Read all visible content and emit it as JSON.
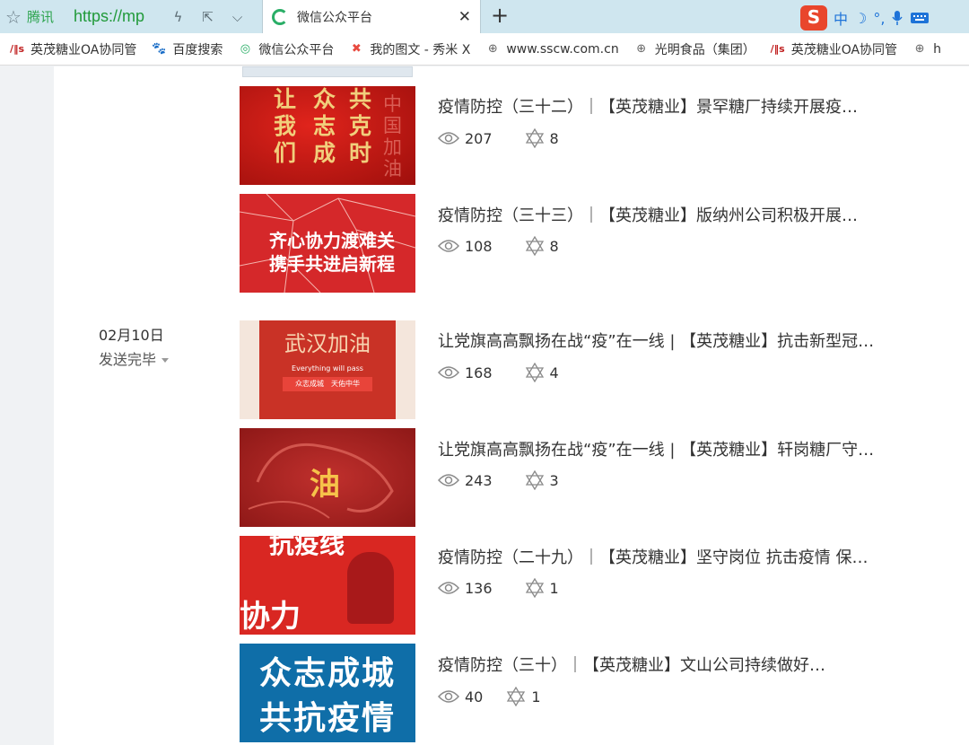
{
  "browser": {
    "brand": "腾讯",
    "url": "https://mp",
    "tab": {
      "title": "微信公众平台"
    },
    "ime": {
      "lang": "中",
      "moon": "☽",
      "punct": "°,"
    }
  },
  "bookmarks": [
    {
      "label": "英茂糖业OA协同管",
      "icon": "oa-logo-icon"
    },
    {
      "label": "百度搜索",
      "icon": "baidu-paw-icon"
    },
    {
      "label": "微信公众平台",
      "icon": "wechat-icon"
    },
    {
      "label": "我的图文 - 秀米 X",
      "icon": "xiumi-icon"
    },
    {
      "label": "www.sscw.com.cn",
      "icon": "globe-icon"
    },
    {
      "label": "光明食品（集团）",
      "icon": "globe-icon"
    },
    {
      "label": "英茂糖业OA协同管",
      "icon": "oa-logo-icon"
    },
    {
      "label": "h",
      "icon": "globe-icon"
    }
  ],
  "group": {
    "date": "02月10日",
    "status": "发送完毕"
  },
  "articles": [
    {
      "title": "疫情防控（三十二）｜【英茂糖业】景罕糖厂持续开展疫…",
      "views": "207",
      "likes": "8",
      "thumb": {
        "lines": [
          "让",
          "我",
          "们"
        ],
        "lines2": [
          "众",
          "志",
          "成"
        ],
        "lines3": [
          "共",
          "克",
          "时"
        ],
        "vert": "中国加油"
      }
    },
    {
      "title": "疫情防控（三十三）｜【英茂糖业】版纳州公司积极开展…",
      "views": "108",
      "likes": "8",
      "thumb": {
        "line1": "齐心协力渡难关",
        "line2": "携手共进启新程"
      }
    },
    {
      "title": "让党旗高高飘扬在战“疫”在一线 | 【英茂糖业】抗击新型冠…",
      "views": "168",
      "likes": "4",
      "thumb": {
        "headline": "武汉加油",
        "en": "Everything will pass",
        "band": "众志成城　天佑中华"
      }
    },
    {
      "title": "让党旗高高飘扬在战“疫”在一线 | 【英茂糖业】轩岗糖厂守…",
      "views": "243",
      "likes": "3",
      "thumb": {
        "zi": "油"
      }
    },
    {
      "title": "疫情防控（二十九）｜【英茂糖业】坚守岗位 抗击疫情 保…",
      "views": "136",
      "likes": "1",
      "thumb": {
        "top": "抗疫线",
        "mid": "协力"
      }
    },
    {
      "title": "疫情防控（三十）｜【英茂糖业】文山公司持续做好…",
      "views": "40",
      "likes": "1",
      "thumb": {
        "line1": "众志成城",
        "line2": "共抗疫情"
      }
    }
  ]
}
